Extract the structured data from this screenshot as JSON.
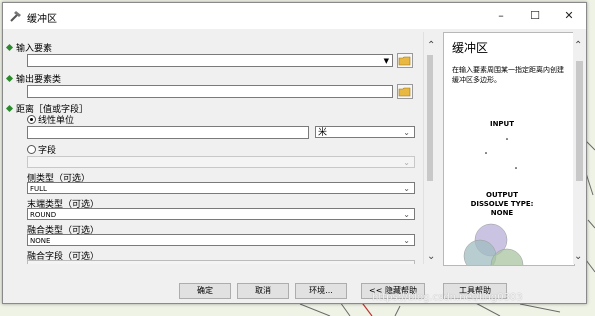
{
  "window": {
    "title": "缓冲区",
    "minimize": "–",
    "maximize": "☐",
    "close": "✕"
  },
  "form": {
    "input_features": {
      "label": "输入要素",
      "value": ""
    },
    "output_feature_class": {
      "label": "输出要素类",
      "value": ""
    },
    "distance": {
      "label": "距离［值或字段］",
      "linear_unit_option": "线性单位",
      "linear_unit_selected": true,
      "linear_value": "",
      "unit": "米",
      "field_option": "字段",
      "field_value": ""
    },
    "side_type": {
      "label": "侧类型（可选）",
      "value": "FULL"
    },
    "end_type": {
      "label": "末端类型（可选）",
      "value": "ROUND"
    },
    "dissolve_type": {
      "label": "融合类型（可选）",
      "value": "NONE"
    },
    "dissolve_field": {
      "label": "融合字段（可选）"
    }
  },
  "help": {
    "title": "缓冲区",
    "description": "在输入要素周围某一指定距离内创建缓冲区多边形。",
    "figure_input": "INPUT",
    "figure_output_1": "OUTPUT",
    "figure_output_2": "DISSOLVE TYPE:",
    "figure_output_3": "NONE"
  },
  "buttons": {
    "ok": "确定",
    "cancel": "取消",
    "environments": "环境...",
    "hide_help": "<< 隐藏帮助",
    "tool_help": "工具帮助"
  },
  "watermark": "https://blog.csdn.net/ling0303",
  "colors": {
    "required_marker": "#2b8a2b",
    "circle_purple": "#b8b0d8",
    "circle_teal": "#9fbcc0",
    "circle_green": "#a8c4a0"
  }
}
